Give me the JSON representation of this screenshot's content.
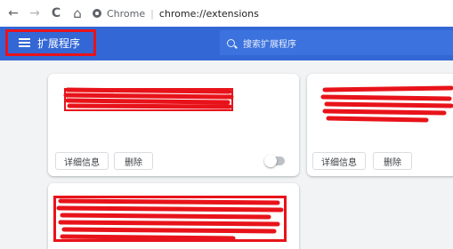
{
  "browser": {
    "back": "←",
    "forward": "→",
    "reload": "C",
    "home": "⌂",
    "site_name": "Chrome",
    "separator": "|",
    "url": "chrome://extensions"
  },
  "header": {
    "title": "扩展程序",
    "search_placeholder": "搜索扩展程序"
  },
  "cards": [
    {
      "details_label": "详细信息",
      "remove_label": "删除",
      "enabled": false
    },
    {
      "details_label": "详细信息",
      "remove_label": "删除"
    },
    {}
  ],
  "colors": {
    "header_bg": "#3367d6",
    "highlight": "#e8131a"
  }
}
